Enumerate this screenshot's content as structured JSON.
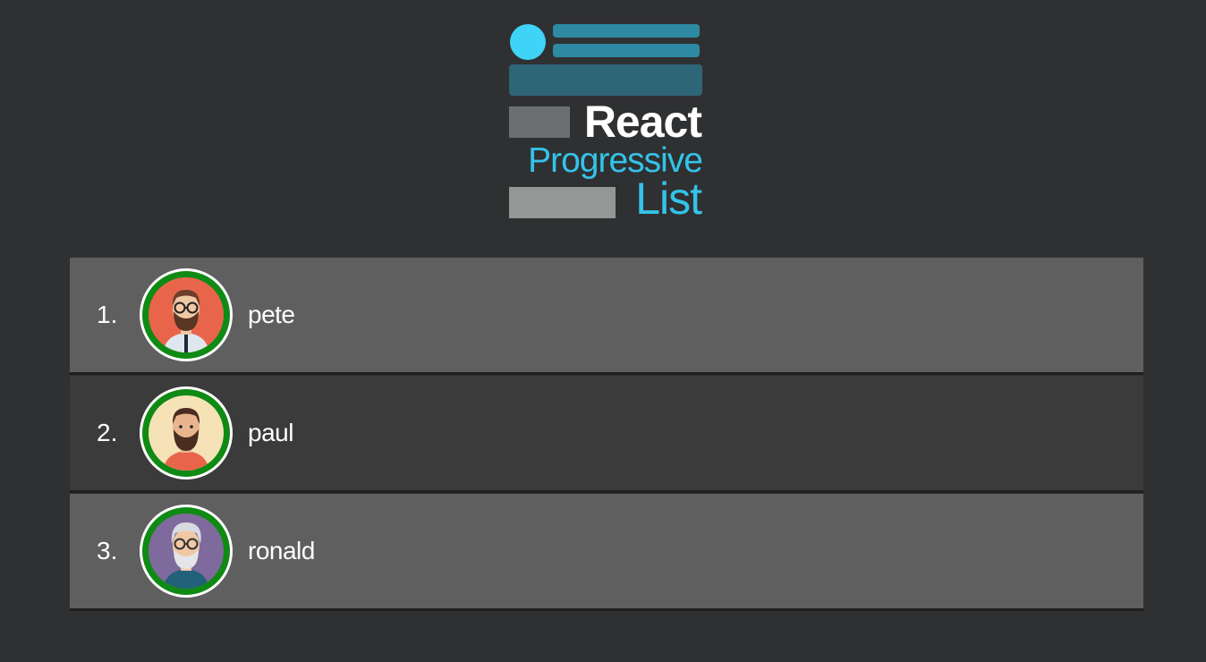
{
  "logo": {
    "word1": "React",
    "word2": "Progressive",
    "word3": "List"
  },
  "colors": {
    "background": "#2f3032",
    "row_light": "#5f5f5f",
    "row_dark": "#3b3b3b",
    "avatar_ring": "#0f8a14",
    "logo_cyan": "#3fd3f7"
  },
  "items": [
    {
      "number": "1.",
      "name": "pete",
      "avatar": "bearded-man-glasses-avatar"
    },
    {
      "number": "2.",
      "name": "paul",
      "avatar": "bearded-man-avatar"
    },
    {
      "number": "3.",
      "name": "ronald",
      "avatar": "old-man-glasses-avatar"
    }
  ]
}
